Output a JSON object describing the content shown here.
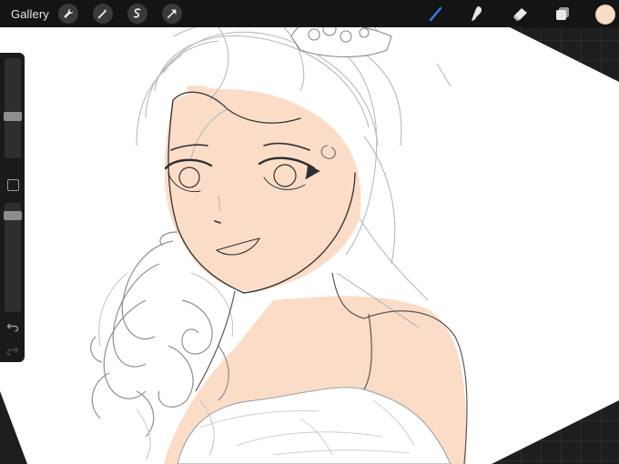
{
  "toolbar": {
    "gallery_label": "Gallery",
    "left_tools": [
      {
        "name": "wrench-icon"
      },
      {
        "name": "magic-wand-icon"
      },
      {
        "name": "selection-icon"
      },
      {
        "name": "transform-arrow-icon"
      }
    ],
    "right_tools": [
      {
        "name": "brush-icon",
        "active": true
      },
      {
        "name": "smudge-icon"
      },
      {
        "name": "eraser-icon"
      },
      {
        "name": "layers-icon"
      }
    ],
    "current_color": "#f7dcc8"
  },
  "sidebar": {
    "controls": [
      "brush-size-slider",
      "modify-button",
      "opacity-slider",
      "undo-button",
      "redo-button"
    ]
  },
  "colors": {
    "accent": "#2f7cf6",
    "skin": "#fbddc7",
    "line": "#3a3a3a",
    "sketch": "#b9b9bd"
  }
}
